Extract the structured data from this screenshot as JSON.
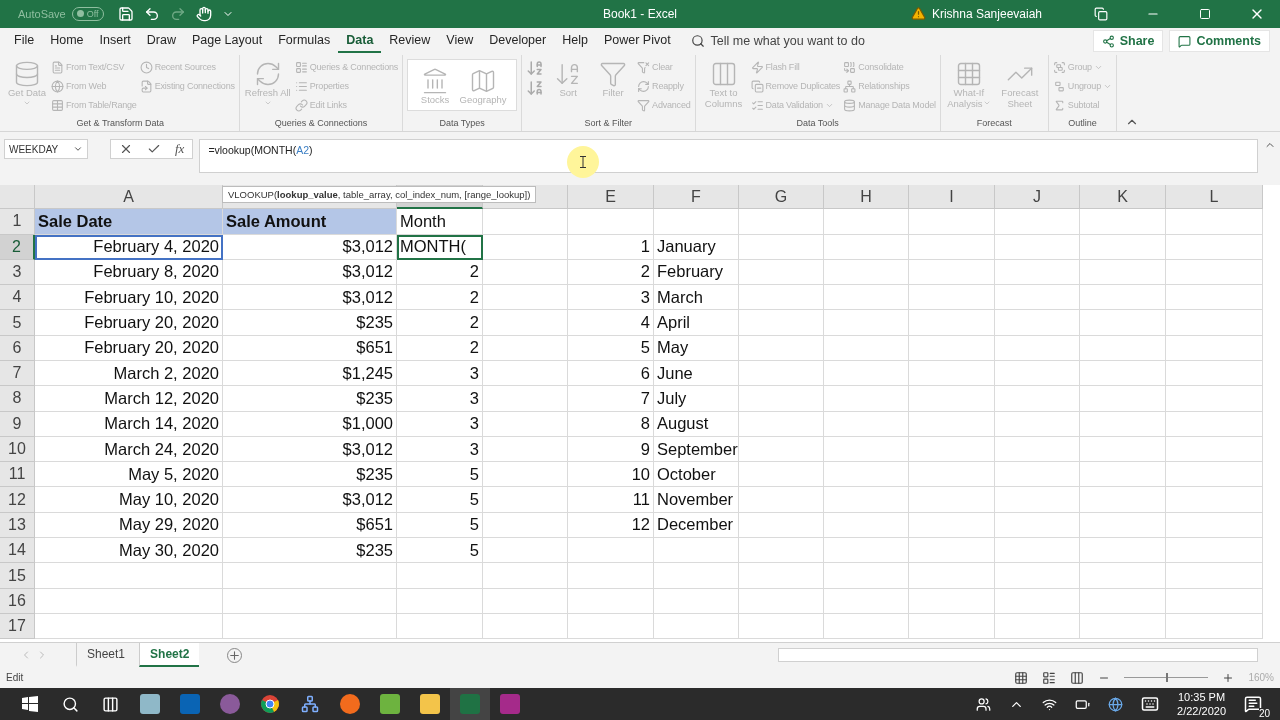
{
  "title_bar": {
    "autosave_label": "AutoSave",
    "autosave_state": "Off",
    "autosave_on": false,
    "title": "Book1  -  Excel",
    "user": "Krishna Sanjeevaiah"
  },
  "menu_tabs": [
    {
      "label": "File",
      "selected": false
    },
    {
      "label": "Home",
      "selected": false
    },
    {
      "label": "Insert",
      "selected": false
    },
    {
      "label": "Draw",
      "selected": false
    },
    {
      "label": "Page Layout",
      "selected": false
    },
    {
      "label": "Formulas",
      "selected": false
    },
    {
      "label": "Data",
      "selected": true
    },
    {
      "label": "Review",
      "selected": false
    },
    {
      "label": "View",
      "selected": false
    },
    {
      "label": "Developer",
      "selected": false
    },
    {
      "label": "Help",
      "selected": false
    },
    {
      "label": "Power Pivot",
      "selected": false
    }
  ],
  "tell_me": "Tell me what you want to do",
  "share": "Share",
  "comments": "Comments",
  "ribbon_groups": [
    {
      "label": "Get & Transform Data",
      "kind": "buttons",
      "disabled": true,
      "items": [
        {
          "kind": "large",
          "label": "Get Data",
          "dropdown": true
        },
        {
          "kind": "small",
          "label": "From Text/CSV"
        },
        {
          "kind": "small",
          "label": "From Web"
        },
        {
          "kind": "small",
          "label": "From Table/Range"
        },
        {
          "kind": "small",
          "label": "Recent Sources"
        },
        {
          "kind": "small",
          "label": "Existing Connections"
        }
      ]
    },
    {
      "label": "Queries & Connections",
      "kind": "buttons",
      "disabled": true,
      "items": [
        {
          "kind": "large",
          "label": "Refresh All",
          "dropdown": true
        },
        {
          "kind": "small",
          "label": "Queries & Connections"
        },
        {
          "kind": "small",
          "label": "Properties"
        },
        {
          "kind": "small",
          "label": "Edit Links"
        }
      ]
    },
    {
      "label": "Data Types",
      "kind": "gallery",
      "disabled": true,
      "items": [
        {
          "kind": "large",
          "label": "Stocks"
        },
        {
          "kind": "large",
          "label": "Geography"
        }
      ]
    },
    {
      "label": "Sort & Filter",
      "kind": "buttons",
      "disabled": true,
      "items": [
        {
          "kind": "sort_icons"
        },
        {
          "kind": "large",
          "label": "Sort"
        },
        {
          "kind": "large",
          "label": "Filter"
        },
        {
          "kind": "small",
          "label": "Clear"
        },
        {
          "kind": "small",
          "label": "Reapply"
        },
        {
          "kind": "small",
          "label": "Advanced"
        }
      ]
    },
    {
      "label": "Data Tools",
      "kind": "buttons",
      "disabled": true,
      "items": [
        {
          "kind": "large",
          "label": "Text to Columns"
        },
        {
          "kind": "small",
          "label": "Flash Fill"
        },
        {
          "kind": "small",
          "label": "Remove Duplicates"
        },
        {
          "kind": "small",
          "label": "Data Validation",
          "dropdown": true
        },
        {
          "kind": "small",
          "label": "Consolidate"
        },
        {
          "kind": "small",
          "label": "Relationships"
        },
        {
          "kind": "small",
          "label": "Manage Data Model"
        }
      ]
    },
    {
      "label": "Forecast",
      "kind": "buttons",
      "disabled": true,
      "items": [
        {
          "kind": "large",
          "label": "What-If Analysis",
          "dropdown": true
        },
        {
          "kind": "large",
          "label": "Forecast Sheet"
        }
      ]
    },
    {
      "label": "Outline",
      "kind": "buttons",
      "disabled": true,
      "items": [
        {
          "kind": "small",
          "label": "Group",
          "dropdown": true
        },
        {
          "kind": "small",
          "label": "Ungroup",
          "dropdown": true
        },
        {
          "kind": "small",
          "label": "Subtotal"
        }
      ]
    }
  ],
  "formula_bar": {
    "name_box": "WEEKDAY",
    "function_button": "fx",
    "parts": [
      {
        "text": "=vlookup(MONTH(",
        "reference": false
      },
      {
        "text": "A2",
        "reference": true
      },
      {
        "text": ")",
        "reference": false
      }
    ],
    "tooltip": "VLOOKUP(**lookup_value**, table_array, col_index_num, [range_lookup])"
  },
  "columns": [
    {
      "label": "A",
      "selected": false
    },
    {
      "selected": false
    },
    {
      "selected": true
    },
    {
      "selected": false
    },
    {
      "label": "E",
      "selected": false
    },
    {
      "label": "F",
      "selected": false
    },
    {
      "label": "G",
      "selected": false
    },
    {
      "label": "H",
      "selected": false
    },
    {
      "label": "I",
      "selected": false
    },
    {
      "label": "J",
      "selected": false
    },
    {
      "label": "K",
      "selected": false
    },
    {
      "label": "L",
      "selected": false
    }
  ],
  "rows": [
    {
      "number": "1",
      "selected": false,
      "editing": false,
      "referenced": false,
      "sale_date": {
        "text": "Sale Date",
        "filled": true
      },
      "amount": {
        "text": "Sale Amount",
        "filled": true
      },
      "month": {
        "text": "Month",
        "filled": false
      }
    },
    {
      "number": "2",
      "selected": true,
      "editing": true,
      "referenced": true,
      "sale_date": "February 4, 2020",
      "amount": "$3,012",
      "month": "MONTH(",
      "index": "1",
      "month_name": "January"
    },
    {
      "number": "3",
      "selected": false,
      "editing": false,
      "referenced": false,
      "sale_date": "February 8, 2020",
      "amount": "$3,012",
      "month": "2",
      "index": "2",
      "month_name": "February"
    },
    {
      "number": "4",
      "selected": false,
      "editing": false,
      "referenced": false,
      "sale_date": "February 10, 2020",
      "amount": "$3,012",
      "month": "2",
      "index": "3",
      "month_name": "March"
    },
    {
      "number": "5",
      "selected": false,
      "editing": false,
      "referenced": false,
      "sale_date": "February 20, 2020",
      "amount": "$235",
      "month": "2",
      "index": "4",
      "month_name": "April"
    },
    {
      "number": "6",
      "selected": false,
      "editing": false,
      "referenced": false,
      "sale_date": "February 20, 2020",
      "amount": "$651",
      "month": "2",
      "index": "5",
      "month_name": "May"
    },
    {
      "number": "7",
      "selected": false,
      "editing": false,
      "referenced": false,
      "sale_date": "March 2, 2020",
      "amount": "$1,245",
      "month": "3",
      "index": "6",
      "month_name": "June"
    },
    {
      "number": "8",
      "selected": false,
      "editing": false,
      "referenced": false,
      "sale_date": "March 12, 2020",
      "amount": "$235",
      "month": "3",
      "index": "7",
      "month_name": "July"
    },
    {
      "number": "9",
      "selected": false,
      "editing": false,
      "referenced": false,
      "sale_date": "March 14, 2020",
      "amount": "$1,000",
      "month": "3",
      "index": "8",
      "month_name": "August"
    },
    {
      "number": "10",
      "selected": false,
      "editing": false,
      "referenced": false,
      "sale_date": "March 24, 2020",
      "amount": "$3,012",
      "month": "3",
      "index": "9",
      "month_name": "September"
    },
    {
      "number": "11",
      "selected": false,
      "editing": false,
      "referenced": false,
      "sale_date": "May 5, 2020",
      "amount": "$235",
      "month": "5",
      "index": "10",
      "month_name": "October"
    },
    {
      "number": "12",
      "selected": false,
      "editing": false,
      "referenced": false,
      "sale_date": "May 10, 2020",
      "amount": "$3,012",
      "month": "5",
      "index": "11",
      "month_name": "November"
    },
    {
      "number": "13",
      "selected": false,
      "editing": false,
      "referenced": false,
      "sale_date": "May 29, 2020",
      "amount": "$651",
      "month": "5",
      "index": "12",
      "month_name": "December"
    },
    {
      "number": "14",
      "selected": false,
      "editing": false,
      "referenced": false,
      "sale_date": "May 30, 2020",
      "amount": "$235",
      "month": "5"
    },
    {
      "number": "15",
      "selected": false,
      "editing": false,
      "referenced": false
    },
    {
      "number": "16",
      "selected": false,
      "editing": false,
      "referenced": false
    },
    {
      "number": "17",
      "selected": false,
      "editing": false,
      "referenced": false
    }
  ],
  "sheet_tabs": [
    {
      "label": "Sheet1",
      "selected": false
    },
    {
      "label": "Sheet2",
      "selected": true
    }
  ],
  "status_bar": {
    "mode": "Edit",
    "zoom": "160%",
    "zoom_level": {
      "level": 0.5
    }
  },
  "taskbar": {
    "time": "10:35 PM",
    "date": "2/22/2020",
    "notifications": "20"
  }
}
